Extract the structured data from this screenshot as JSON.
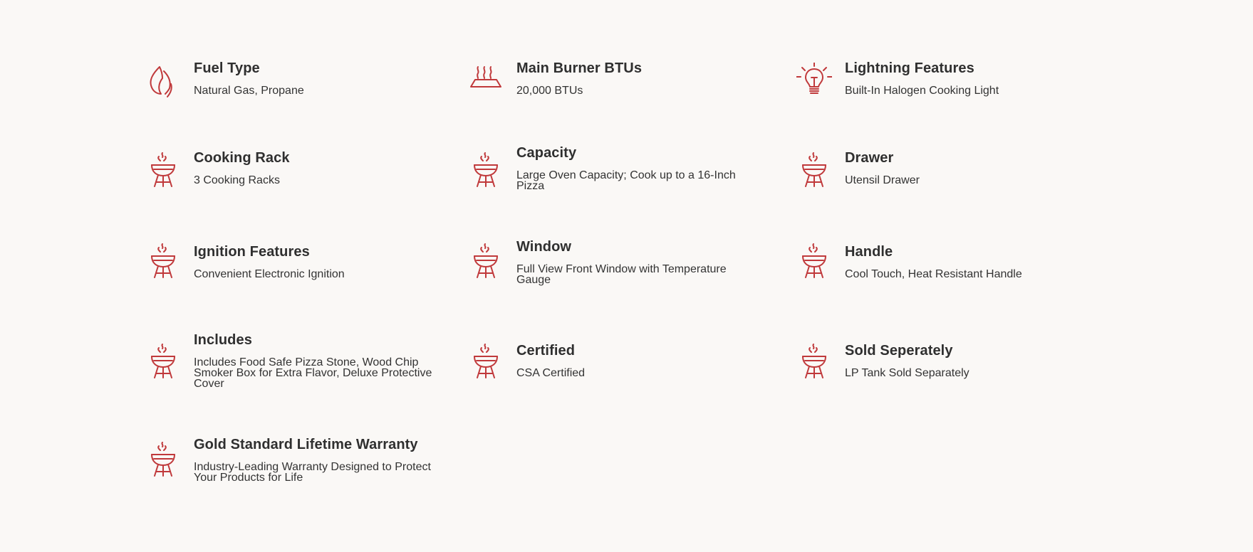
{
  "accent_color": "#c0393b",
  "specs": [
    {
      "icon": "flame-icon",
      "title": "Fuel Type",
      "value": "Natural Gas, Propane"
    },
    {
      "icon": "burner-heat-icon",
      "title": "Main Burner BTUs",
      "value": "20,000 BTUs"
    },
    {
      "icon": "light-bulb-icon",
      "title": "Lightning Features",
      "value": "Built-In Halogen Cooking Light"
    },
    {
      "icon": "grill-icon",
      "title": "Cooking Rack",
      "value": "3 Cooking Racks"
    },
    {
      "icon": "grill-icon",
      "title": "Capacity",
      "value": "Large Oven Capacity; Cook up to a 16-Inch Pizza"
    },
    {
      "icon": "grill-icon",
      "title": "Drawer",
      "value": "Utensil Drawer"
    },
    {
      "icon": "grill-icon",
      "title": "Ignition Features",
      "value": "Convenient Electronic Ignition"
    },
    {
      "icon": "grill-icon",
      "title": "Window",
      "value": "Full View Front Window with Temperature Gauge"
    },
    {
      "icon": "grill-icon",
      "title": "Handle",
      "value": "Cool Touch, Heat Resistant Handle"
    },
    {
      "icon": "grill-icon",
      "title": "Includes",
      "value": "Includes Food Safe Pizza Stone, Wood Chip Smoker Box for Extra Flavor, Deluxe Protective Cover"
    },
    {
      "icon": "grill-icon",
      "title": "Certified",
      "value": "CSA Certified"
    },
    {
      "icon": "grill-icon",
      "title": "Sold Seperately",
      "value": "LP Tank Sold Separately"
    },
    {
      "icon": "grill-icon",
      "title": "Gold Standard Lifetime Warranty",
      "value": "Industry-Leading Warranty Designed to Protect Your Products for Life"
    }
  ]
}
